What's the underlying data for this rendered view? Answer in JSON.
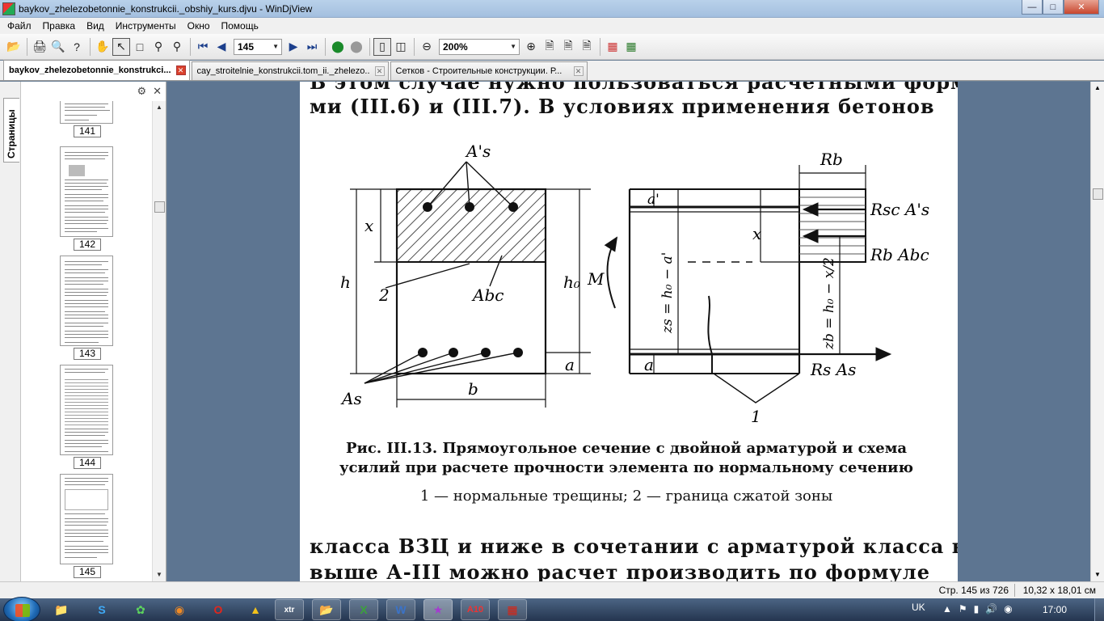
{
  "window": {
    "title": "baykov_zhelezobetonnie_konstrukcii._obshiy_kurs.djvu - WinDjView",
    "controls": {
      "minimize": "—",
      "maximize": "□",
      "close": "✕"
    }
  },
  "menu": [
    "Файл",
    "Правка",
    "Вид",
    "Инструменты",
    "Окно",
    "Помощь"
  ],
  "toolbar": {
    "page_number": "145",
    "zoom": "200%",
    "icons": [
      "open-icon",
      "print-icon",
      "find-icon",
      "help-icon",
      "hand-tool-icon",
      "select-tool-icon",
      "marquee-tool-icon",
      "zoom-in-tool-icon",
      "zoom-rect-icon",
      "first-page-icon",
      "prev-page-icon",
      "next-page-icon",
      "last-page-icon",
      "back-icon",
      "forward-icon",
      "single-page-icon",
      "two-page-icon",
      "zoom-out-icon",
      "zoom-in-icon",
      "actual-size-icon",
      "fit-page-icon",
      "rotate-left-icon",
      "rotate-right-icon"
    ]
  },
  "tabs": [
    {
      "label": "baykov_zhelezobetonnie_konstrukci...",
      "active": true
    },
    {
      "label": "cay_stroitelnie_konstrukcii.tom_ii._zhelezo...",
      "active": false
    },
    {
      "label": "Сетков - Строительные конструкции. Р...",
      "active": false
    }
  ],
  "sidebar": {
    "tab_label": "Страницы",
    "pages": [
      "141",
      "142",
      "143",
      "144",
      "145"
    ]
  },
  "document": {
    "top_partial_line": "В этом случае нужно пользоваться расчетными формула-",
    "line1": "ми (III.6) и (III.7). В условиях применения бетонов",
    "caption_line1": "Рис. III.13. Прямоугольное сечение с двойной арматурой и схема",
    "caption_line2": "усилий при расчете прочности элемента по нормальному сечению",
    "legend": "1 — нормальные трещины; 2 — граница сжатой зоны",
    "line2": "класса ВЗЦ и ниже в сочетании с арматурой класса не",
    "line3": "выше А-III можно расчет производить по формуле",
    "figure_labels": {
      "As_prime": "A's",
      "x": "x",
      "h": "h",
      "h0": "h₀",
      "M": "M",
      "two": "2",
      "Abc": "Abc",
      "a": "a",
      "b": "b",
      "As": "As",
      "a_prime": "a'",
      "Rb": "Rb",
      "Rsc_As": "Rsc A's",
      "Rb_Abc": "Rb Abc",
      "zs": "zs = h₀ − a'",
      "zb": "zb = h₀ − x/2",
      "Rs_As": "Rs As",
      "one": "1"
    }
  },
  "status": {
    "pages": "Стр. 145 из 726",
    "size": "10,32 x 18,01 см"
  },
  "taskbar": {
    "apps": [
      "explorer-icon",
      "skype-icon",
      "app-green-icon",
      "firefox-icon",
      "opera-icon",
      "app-yellow-icon",
      "xtr-icon",
      "app-folder-icon",
      "excel-icon",
      "word-icon",
      "windjview-icon",
      "app-a10-icon",
      "acrobat-icon"
    ],
    "tray": {
      "language": "UK",
      "time": "17:00"
    }
  }
}
